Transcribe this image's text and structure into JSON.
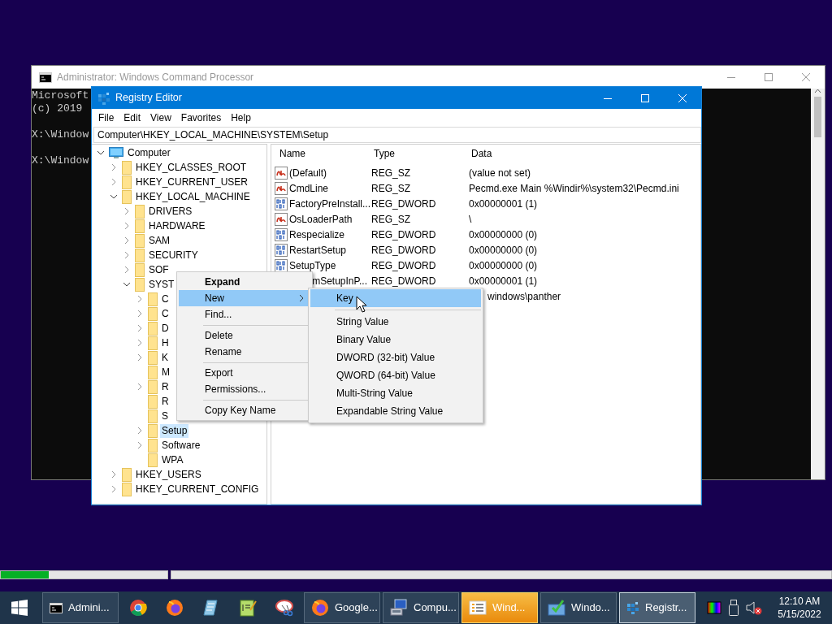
{
  "cmd_window": {
    "title": "Administrator: Windows Command Processor",
    "console": [
      [
        "Microsoft",
        "(c) 2019"
      ],
      [
        "X:\\Window"
      ],
      [
        "X:\\Window"
      ]
    ]
  },
  "regedit": {
    "title": "Registry Editor",
    "menu": [
      "File",
      "Edit",
      "View",
      "Favorites",
      "Help"
    ],
    "address": "Computer\\HKEY_LOCAL_MACHINE\\SYSTEM\\Setup",
    "tree": [
      {
        "label": "Computer",
        "kind": "computer",
        "expanded": true,
        "selected": false,
        "children": [
          {
            "label": "HKEY_CLASSES_ROOT",
            "kind": "folder",
            "expanded": false,
            "selected": false
          },
          {
            "label": "HKEY_CURRENT_USER",
            "kind": "folder",
            "expanded": false,
            "selected": false
          },
          {
            "label": "HKEY_LOCAL_MACHINE",
            "kind": "folder",
            "expanded": true,
            "selected": false,
            "children": [
              {
                "label": "DRIVERS",
                "kind": "folder",
                "expanded": false,
                "selected": false
              },
              {
                "label": "HARDWARE",
                "kind": "folder",
                "expanded": false,
                "selected": false
              },
              {
                "label": "SAM",
                "kind": "folder",
                "expanded": false,
                "selected": false
              },
              {
                "label": "SECURITY",
                "kind": "folder",
                "expanded": false,
                "selected": false
              },
              {
                "label": "SOF",
                "kind": "folder",
                "expanded": false,
                "selected": false
              },
              {
                "label": "SYST",
                "kind": "folder",
                "expanded": true,
                "selected": false,
                "children": [
                  {
                    "label": "C",
                    "kind": "folder",
                    "expanded": false,
                    "selected": false
                  },
                  {
                    "label": "C",
                    "kind": "folder",
                    "expanded": false,
                    "selected": false
                  },
                  {
                    "label": "D",
                    "kind": "folder",
                    "expanded": false,
                    "selected": false
                  },
                  {
                    "label": "H",
                    "kind": "folder",
                    "expanded": false,
                    "selected": false
                  },
                  {
                    "label": "K",
                    "kind": "folder",
                    "expanded": false,
                    "selected": false
                  },
                  {
                    "label": "M",
                    "kind": "folder",
                    "selected": false
                  },
                  {
                    "label": "R",
                    "kind": "folder",
                    "expanded": false,
                    "selected": false
                  },
                  {
                    "label": "R",
                    "kind": "folder",
                    "selected": false
                  },
                  {
                    "label": "S",
                    "kind": "folder",
                    "selected": false
                  },
                  {
                    "label": "Setup",
                    "kind": "folder",
                    "expanded": false,
                    "selected": true
                  },
                  {
                    "label": "Software",
                    "kind": "folder",
                    "expanded": false,
                    "selected": false
                  },
                  {
                    "label": "WPA",
                    "kind": "folder",
                    "selected": false
                  }
                ]
              }
            ]
          },
          {
            "label": "HKEY_USERS",
            "kind": "folder",
            "expanded": false,
            "selected": false
          },
          {
            "label": "HKEY_CURRENT_CONFIG",
            "kind": "folder",
            "expanded": false,
            "selected": false
          }
        ]
      }
    ],
    "columns": [
      "Name",
      "Type",
      "Data"
    ],
    "values": [
      {
        "kind": "string",
        "name": "(Default)",
        "type": "REG_SZ",
        "data": "(value not set)"
      },
      {
        "kind": "string",
        "name": "CmdLine",
        "type": "REG_SZ",
        "data": "Pecmd.exe Main %Windir%\\system32\\Pecmd.ini"
      },
      {
        "kind": "binary",
        "name": "FactoryPreInstall...",
        "type": "REG_DWORD",
        "data": "0x00000001 (1)"
      },
      {
        "kind": "string",
        "name": "OsLoaderPath",
        "type": "REG_SZ",
        "data": "\\"
      },
      {
        "kind": "binary",
        "name": "Respecialize",
        "type": "REG_DWORD",
        "data": "0x00000000 (0)"
      },
      {
        "kind": "binary",
        "name": "RestartSetup",
        "type": "REG_DWORD",
        "data": "0x00000000 (0)"
      },
      {
        "kind": "binary",
        "name": "SetupType",
        "type": "REG_DWORD",
        "data": "0x00000000 (0)"
      },
      {
        "name": "mSetupInP...",
        "type": "REG_DWORD",
        "data": "0x00000001 (1)"
      },
      {
        "data": "windows\\panther"
      }
    ]
  },
  "context_menu": [
    {
      "kind": "item",
      "label": "Expand",
      "bold": true,
      "selected": false
    },
    {
      "kind": "item",
      "label": "New",
      "has_submenu": true,
      "selected": true
    },
    {
      "kind": "item",
      "label": "Find...",
      "selected": false
    },
    {
      "kind": "separator"
    },
    {
      "kind": "item",
      "label": "Delete",
      "selected": false
    },
    {
      "kind": "item",
      "label": "Rename",
      "selected": false
    },
    {
      "kind": "separator"
    },
    {
      "kind": "item",
      "label": "Export",
      "selected": false
    },
    {
      "kind": "item",
      "label": "Permissions...",
      "selected": false
    },
    {
      "kind": "separator"
    },
    {
      "kind": "item",
      "label": "Copy Key Name",
      "selected": false
    }
  ],
  "submenu": [
    {
      "kind": "item",
      "label": "Key",
      "selected": true
    },
    {
      "kind": "separator"
    },
    {
      "kind": "item",
      "label": "String Value",
      "selected": false
    },
    {
      "kind": "item",
      "label": "Binary Value",
      "selected": false
    },
    {
      "kind": "item",
      "label": "DWORD (32-bit) Value",
      "selected": false
    },
    {
      "kind": "item",
      "label": "QWORD (64-bit) Value",
      "selected": false
    },
    {
      "kind": "item",
      "label": "Multi-String Value",
      "selected": false
    },
    {
      "kind": "item",
      "label": "Expandable String Value",
      "selected": false
    }
  ],
  "progress": [
    {
      "level": 0.29
    },
    {
      "level": 0
    }
  ],
  "taskbar": {
    "items": [
      {
        "kind": "button",
        "label": "Admini...",
        "active": false,
        "flashing": false
      },
      {
        "kind": "pin"
      },
      {
        "kind": "pin"
      },
      {
        "kind": "pin"
      },
      {
        "kind": "pin"
      },
      {
        "kind": "pin"
      },
      {
        "kind": "button",
        "label": "Google...",
        "active": false,
        "flashing": false
      },
      {
        "kind": "button",
        "label": "Compu...",
        "active": false,
        "flashing": false
      },
      {
        "kind": "button",
        "label": "Wind...",
        "active": false,
        "flashing": true
      },
      {
        "kind": "button",
        "label": "Windo...",
        "active": false,
        "flashing": false
      },
      {
        "kind": "button",
        "label": "Registr...",
        "active": true,
        "flashing": false
      }
    ],
    "clock": {
      "time": "12:10 AM",
      "date": "5/15/2022"
    }
  }
}
